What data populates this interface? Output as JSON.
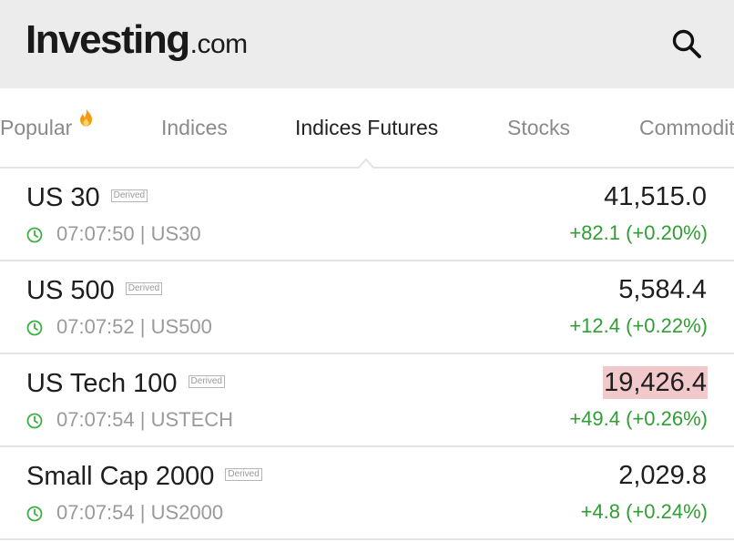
{
  "header": {
    "logo_main": "Investing",
    "logo_suffix": ".com",
    "search_icon": "search-icon"
  },
  "tabs": [
    {
      "label": "Popular",
      "icon": "fire-icon",
      "active": false
    },
    {
      "label": "Indices",
      "active": false
    },
    {
      "label": "Indices Futures",
      "active": true
    },
    {
      "label": "Stocks",
      "active": false
    },
    {
      "label": "Commodities",
      "active": false
    }
  ],
  "rows": [
    {
      "name": "US 30",
      "badge": "Derived",
      "meta": "07:07:50 | US30",
      "price": "41,515.0",
      "change": "+82.1 (+0.20%)"
    },
    {
      "name": "US 500",
      "badge": "Derived",
      "meta": "07:07:52 | US500",
      "price": "5,584.4",
      "change": "+12.4 (+0.22%)"
    },
    {
      "name": "US Tech 100",
      "badge": "Derived",
      "meta": "07:07:54 | USTECH",
      "price": "19,426.4",
      "change": "+49.4 (+0.26%)",
      "price_flash": true
    },
    {
      "name": "Small Cap 2000",
      "badge": "Derived",
      "meta": "07:07:54 | US2000",
      "price": "2,029.8",
      "change": "+4.8 (+0.24%)"
    }
  ],
  "colors": {
    "header_bg": "#ececec",
    "positive": "#2f9e33",
    "clock": "#3cb043",
    "fire": "#f39c12",
    "flash_bg": "#f2c9cb"
  }
}
